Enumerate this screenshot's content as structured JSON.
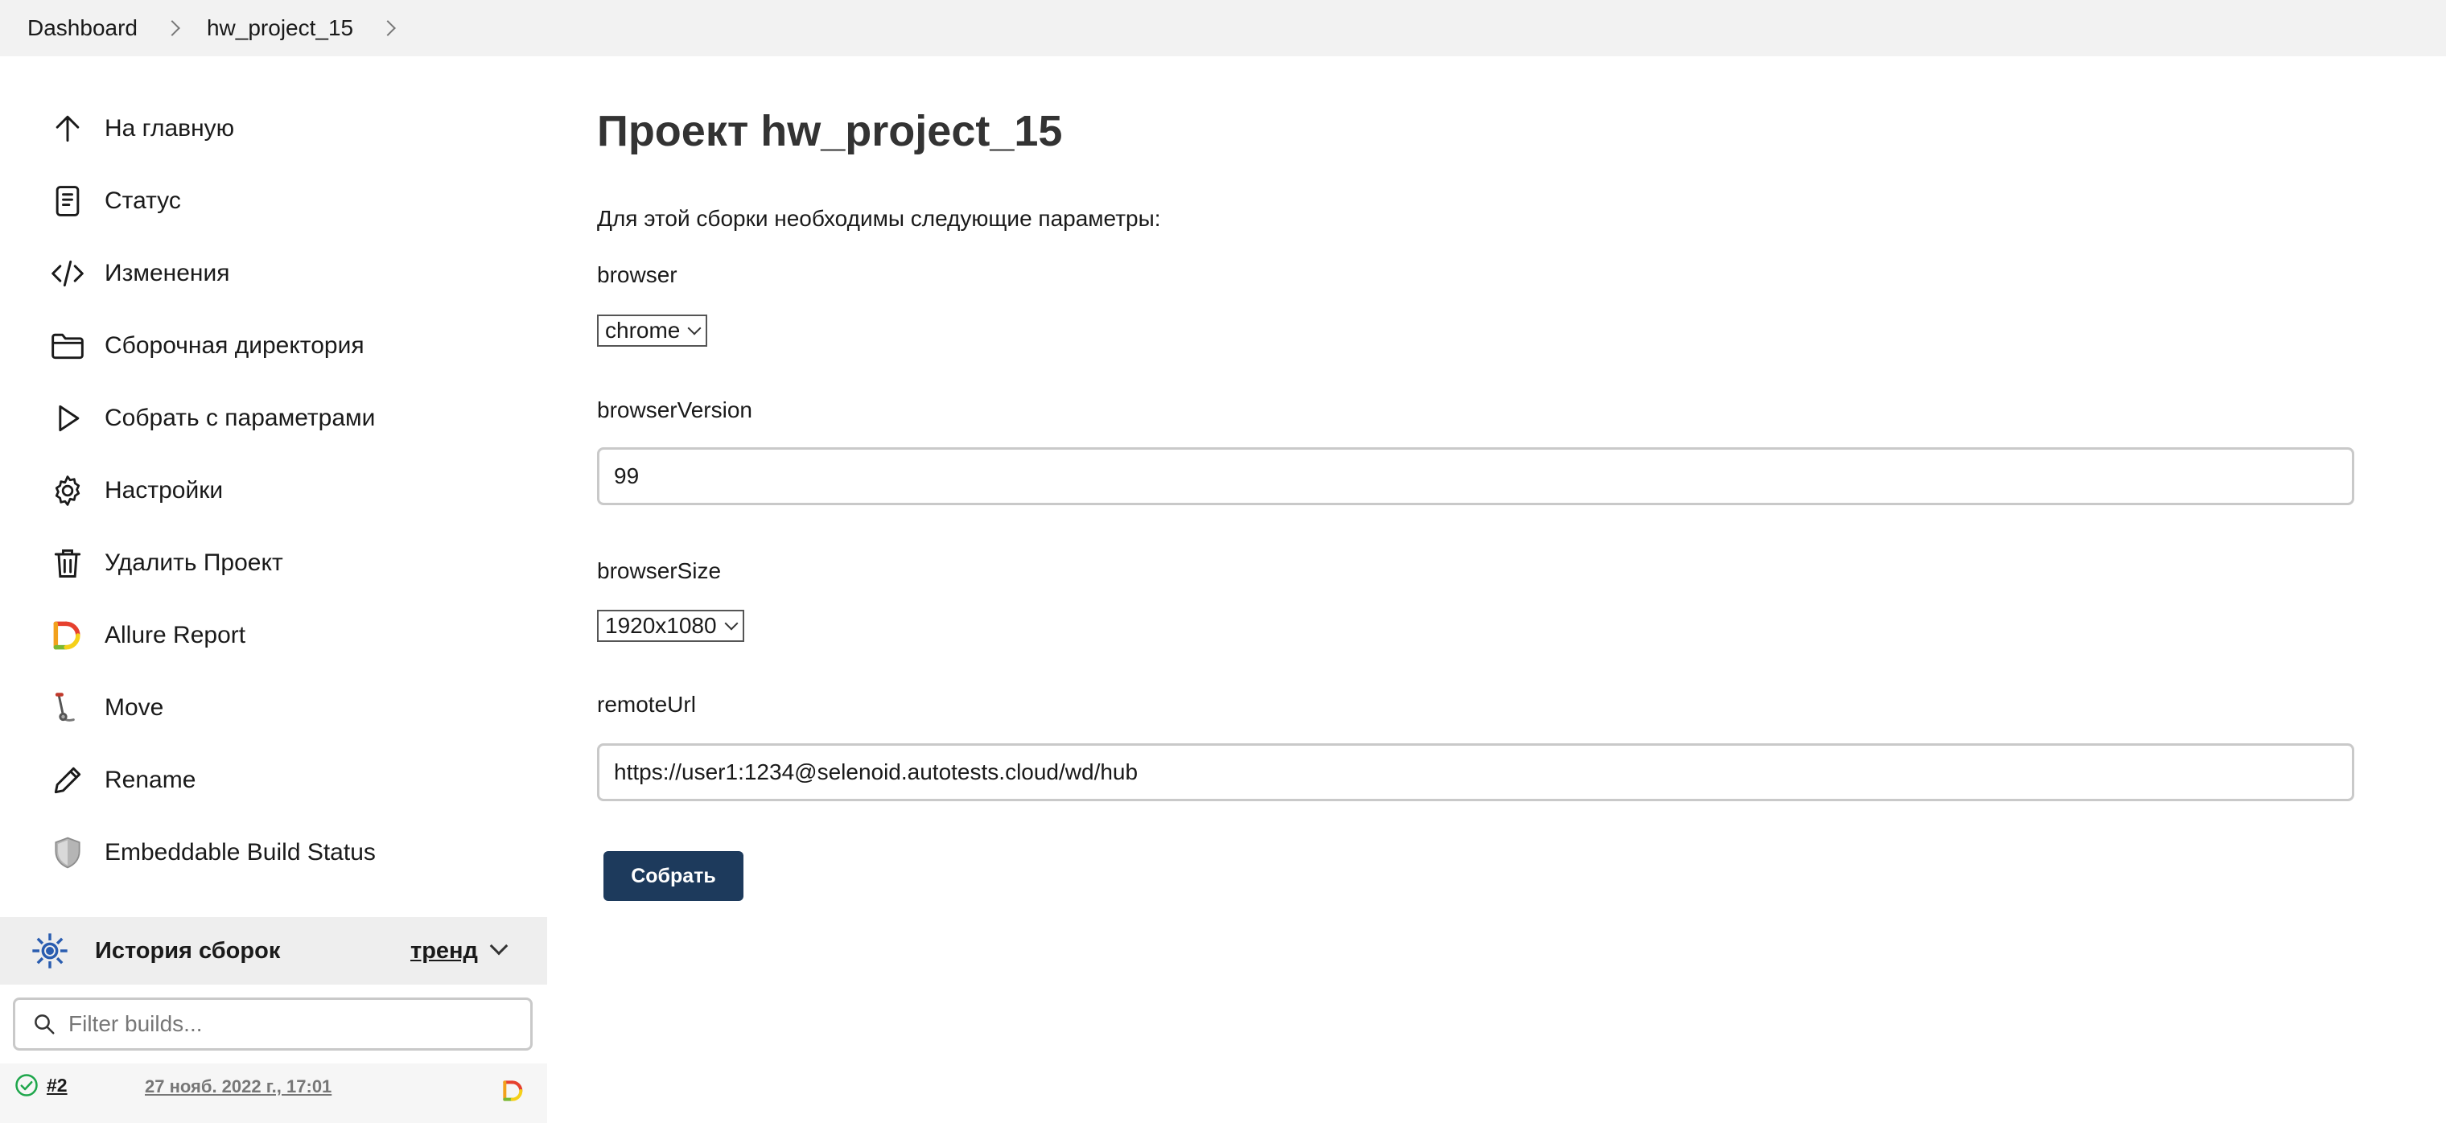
{
  "breadcrumb": {
    "items": [
      "Dashboard",
      "hw_project_15"
    ]
  },
  "sidebar": {
    "items": [
      {
        "label": "На главную",
        "icon": "arrow-up-icon"
      },
      {
        "label": "Статус",
        "icon": "document-icon"
      },
      {
        "label": "Изменения",
        "icon": "code-icon"
      },
      {
        "label": "Сборочная директория",
        "icon": "folder-icon"
      },
      {
        "label": "Собрать с параметрами",
        "icon": "play-icon"
      },
      {
        "label": "Настройки",
        "icon": "gear-icon"
      },
      {
        "label": "Удалить Проект",
        "icon": "trash-icon"
      },
      {
        "label": "Allure Report",
        "icon": "allure-icon"
      },
      {
        "label": "Move",
        "icon": "move-icon"
      },
      {
        "label": "Rename",
        "icon": "pencil-icon"
      },
      {
        "label": "Embeddable Build Status",
        "icon": "shield-icon"
      }
    ]
  },
  "history": {
    "title": "История сборок",
    "trend_label": "тренд",
    "filter_placeholder": "Filter builds...",
    "builds": [
      {
        "number": "#2",
        "date": "27 нояб. 2022 г., 17:01",
        "status": "success"
      }
    ]
  },
  "main": {
    "title": "Проект hw_project_15",
    "intro": "Для этой сборки необходимы следующие параметры:",
    "params": {
      "browser": {
        "label": "browser",
        "value": "chrome"
      },
      "browserVersion": {
        "label": "browserVersion",
        "value": "99"
      },
      "browserSize": {
        "label": "browserSize",
        "value": "1920x1080"
      },
      "remoteUrl": {
        "label": "remoteUrl",
        "value": "https://user1:1234@selenoid.autotests.cloud/wd/hub"
      }
    },
    "submit_label": "Собрать"
  },
  "colors": {
    "primary_button": "#1d3a5c",
    "breadcrumb_bg": "#f2f2f2",
    "success": "#1ea64b"
  }
}
